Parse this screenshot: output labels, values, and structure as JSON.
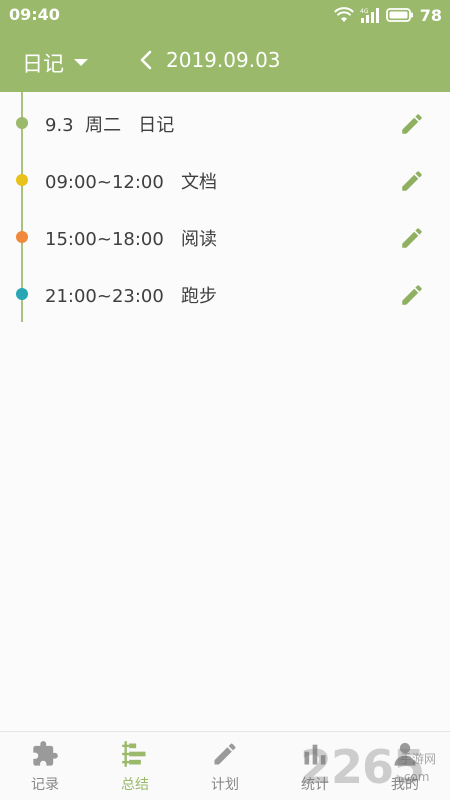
{
  "status_bar": {
    "time": "09:40",
    "battery": "78",
    "icons": [
      "wifi-icon",
      "signal-icon",
      "battery-icon"
    ]
  },
  "app_bar": {
    "journal_type": "日记",
    "date": "2019.09.03"
  },
  "colors": {
    "primary": "#9ab96a",
    "timeline": "#a9c37c",
    "dot_green": "#9ab96a",
    "dot_yellow": "#e8c21a",
    "dot_orange": "#f08a3a",
    "dot_teal": "#27a6b4"
  },
  "entries": [
    {
      "text": "9.3  周二   日记",
      "dot_color": "#9ab96a"
    },
    {
      "text": "09:00~12:00   文档",
      "dot_color": "#e8c21a"
    },
    {
      "text": "15:00~18:00   阅读",
      "dot_color": "#f08a3a"
    },
    {
      "text": "21:00~23:00   跑步",
      "dot_color": "#27a6b4"
    }
  ],
  "tabs": [
    {
      "label": "记录",
      "icon": "puzzle-icon",
      "active": false
    },
    {
      "label": "总结",
      "icon": "list-icon",
      "active": true
    },
    {
      "label": "计划",
      "icon": "pencil-icon",
      "active": false
    },
    {
      "label": "统计",
      "icon": "chart-icon",
      "active": false
    },
    {
      "label": "我的",
      "icon": "person-icon",
      "active": false
    }
  ],
  "watermark": {
    "number": "2265",
    "text_top": "手游网",
    "text_bottom": ".com"
  }
}
